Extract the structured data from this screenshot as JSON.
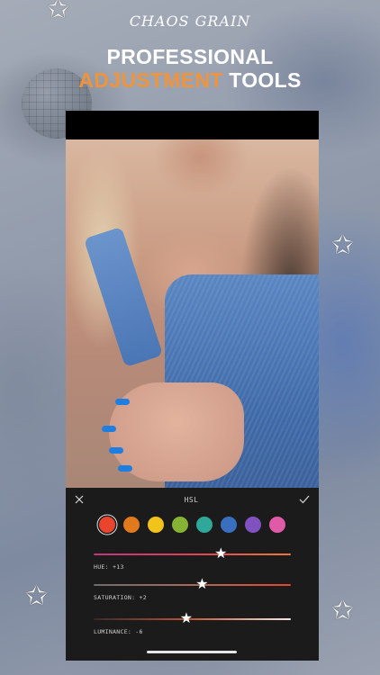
{
  "brand": "CHAOS GRAIN",
  "headline": {
    "line1": "PROFESSIONAL",
    "accent": "ADJUSTMENT",
    "rest": "TOOLS"
  },
  "colors": {
    "accent": "#f0933a",
    "panel_bg": "#1b1b1b"
  },
  "editor": {
    "panel_title": "HSL",
    "close_icon": "close-icon",
    "confirm_icon": "check-icon",
    "swatches": [
      "#e8452e",
      "#e07a1d",
      "#f1c31b",
      "#86b334",
      "#2fa89a",
      "#3a6fc0",
      "#7f52c0",
      "#e05aa8"
    ],
    "selected_swatch": 0,
    "sliders": [
      {
        "label": "HUE: +13",
        "value": 13,
        "min": -100,
        "max": 100
      },
      {
        "label": "SATURATION: +2",
        "value": 2,
        "min": -100,
        "max": 100
      },
      {
        "label": "LUMINANCE: -6",
        "value": -6,
        "min": -100,
        "max": 100
      }
    ]
  }
}
